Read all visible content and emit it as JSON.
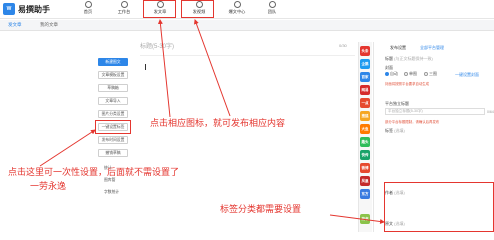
{
  "app": {
    "logo_text": "W",
    "name": "易撰助手"
  },
  "nav": [
    {
      "label": "首页",
      "icon": "home-icon"
    },
    {
      "label": "工作台",
      "icon": "workbench-icon"
    },
    {
      "label": "发文章",
      "icon": "edit-icon"
    },
    {
      "label": "发视频",
      "icon": "play-icon"
    },
    {
      "label": "爆文中心",
      "icon": "fire-icon"
    },
    {
      "label": "团队",
      "icon": "team-icon"
    }
  ],
  "subtabs": [
    {
      "label": "发文章",
      "active": true
    },
    {
      "label": "我的文章",
      "active": false
    }
  ],
  "sidebar": {
    "primary_button": "新建图文",
    "buttons": [
      "文章模板设置",
      "草稿箱",
      "文章导入",
      "图片分类设置",
      "一键设置标签",
      "发布时间设置",
      "撤销草稿"
    ],
    "links": [
      "统计",
      "图库管",
      "字数统计"
    ]
  },
  "editor": {
    "title_placeholder": "标题(5-30字)",
    "title_count": "0/30"
  },
  "platforms": [
    {
      "label": "头条",
      "color": "#e4362f"
    },
    {
      "label": "企鹅",
      "color": "#1e9bf0"
    },
    {
      "label": "百家",
      "color": "#2d86e8"
    },
    {
      "label": "网易",
      "color": "#d52b2b"
    },
    {
      "label": "一点",
      "color": "#e6492e"
    },
    {
      "label": "搜狐",
      "color": "#f5a623"
    },
    {
      "label": "大鱼",
      "color": "#ff7a00"
    },
    {
      "label": "趣头",
      "color": "#2ebd5a"
    },
    {
      "label": "快传",
      "color": "#1aa36a"
    },
    {
      "label": "微博",
      "color": "#e6492e"
    },
    {
      "label": "凤凰",
      "color": "#c52a2a"
    },
    {
      "label": "东方",
      "color": "#3a7be0"
    },
    {
      "label": "简书",
      "color": "#8bc34a"
    }
  ],
  "settings": {
    "tabs": [
      "发布设置",
      "全部平台管理"
    ],
    "title_label": "标题",
    "title_placeholder": "(与正文标题保持一致)",
    "cover_label": "封面",
    "radio": [
      "自动",
      "单图",
      "三图"
    ],
    "radio_link": "一键设置封面",
    "warning_1": "封面将按照平台要求自动生成",
    "platform_title_label": "平台独立标题",
    "platform_title_placeholder": "平台独立标题(5-30字)",
    "title_count": "0/64",
    "warning_2": "部分平台标题限制，请确认后再发布",
    "tag_label": "标签",
    "tag_placeholder": "(选填)",
    "author_label": "作者",
    "author_placeholder": "(选填)",
    "source_label": "原文",
    "source_placeholder": "(选填)"
  },
  "annotations": {
    "publish": "点击相应图标，就可发布相应内容",
    "one_time_line1": "点击这里可一次性设置，后面就不需设置了",
    "one_time_line2": "一劳永逸",
    "tag_setting": "标签分类都需要设置"
  }
}
